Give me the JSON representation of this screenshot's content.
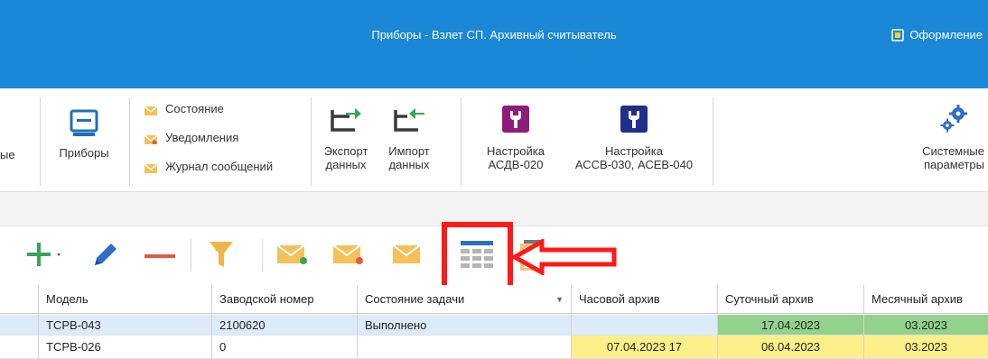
{
  "window": {
    "title": "Приборы - Взлет СП. Архивный считыватель",
    "design_label": "Оформление"
  },
  "ribbon": {
    "cut_label": "ые",
    "devices_label": "Приборы",
    "status_items": [
      "Состояние",
      "Уведомления",
      "Журнал сообщений"
    ],
    "export_label_1": "Экспорт",
    "export_label_2": "данных",
    "import_label_1": "Импорт",
    "import_label_2": "данных",
    "setup1_label_1": "Настройка",
    "setup1_label_2": "АСДВ-020",
    "setup2_label_1": "Настройка",
    "setup2_label_2": "АССВ-030, АСЕВ-040",
    "system_label_1": "Системные",
    "system_label_2": "параметры"
  },
  "toolbar": {
    "icons": [
      "add-icon",
      "edit-icon",
      "remove-icon",
      "filter-icon",
      "mail-icon",
      "mail-icon",
      "mail-icon",
      "table-icon",
      "report-icon"
    ]
  },
  "colors": {
    "title_bar": "#1a88d6",
    "add": "#3aa35b",
    "edit": "#2d6fc4",
    "remove": "#e05a4a",
    "filter": "#f0b54a",
    "mail": "#f3c15a",
    "highlight": "#ff1a1a",
    "cell_green": "#93d28c",
    "cell_yellow": "#fdf08a",
    "selected_row": "#dcebfa"
  },
  "grid": {
    "headers": [
      "Модель",
      "Заводской номер",
      "Состояние задачи",
      "Часовой архив",
      "Суточный архив",
      "Месячный архив"
    ],
    "rows": [
      {
        "model": "ТСРВ-043",
        "serial": "2100620",
        "state": "Выполнено",
        "hourly": "",
        "daily": "17.04.2023",
        "monthly": "03.2023"
      },
      {
        "model": "ТСРВ-026",
        "serial": "0",
        "state": "",
        "hourly": "07.04.2023 17",
        "daily": "06.04.2023",
        "monthly": "03.2023"
      }
    ]
  }
}
